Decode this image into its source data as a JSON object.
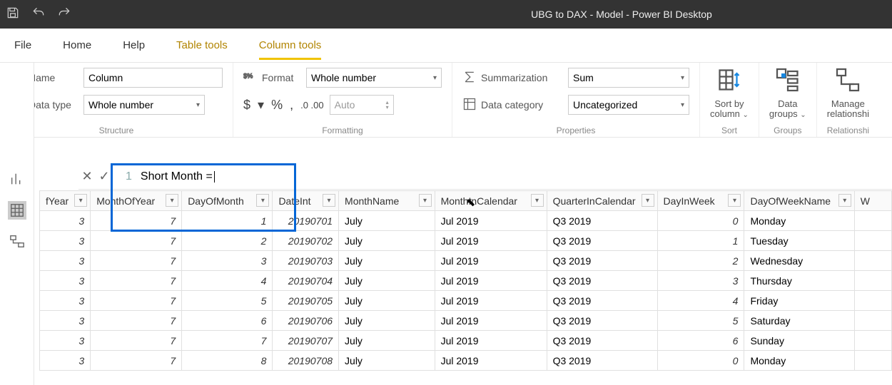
{
  "app": {
    "title": "UBG to DAX - Model - Power BI Desktop"
  },
  "menubar": {
    "file": "File",
    "home": "Home",
    "help": "Help",
    "table_tools": "Table tools",
    "column_tools": "Column tools"
  },
  "ribbon": {
    "structure": {
      "name_label": "Name",
      "name_value": "Column",
      "datatype_label": "Data type",
      "datatype_value": "Whole number",
      "caption": "Structure"
    },
    "formatting": {
      "format_label": "Format",
      "format_value": "Whole number",
      "auto": "Auto",
      "caption": "Formatting"
    },
    "properties": {
      "summarization_label": "Summarization",
      "summarization_value": "Sum",
      "category_label": "Data category",
      "category_value": "Uncategorized",
      "caption": "Properties"
    },
    "sort": {
      "label": "Sort by\ncolumn",
      "chev": "⌄",
      "caption": "Sort"
    },
    "groups": {
      "label": "Data\ngroups",
      "chev": "⌄",
      "caption": "Groups"
    },
    "rel": {
      "label": "Manage\nrelationshi",
      "caption": "Relationshi"
    }
  },
  "formula": {
    "line": "1",
    "text": "Short Month = "
  },
  "columns": [
    "fYear",
    "MonthOfYear",
    "DayOfMonth",
    "DateInt",
    "MonthName",
    "MonthInCalendar",
    "QuarterInCalendar",
    "DayInWeek",
    "DayOfWeekName",
    "W"
  ],
  "rows": [
    {
      "fYear": "3",
      "MonthOfYear": "7",
      "DayOfMonth": "1",
      "DateInt": "20190701",
      "MonthName": "July",
      "MonthInCalendar": "Jul 2019",
      "QuarterInCalendar": "Q3 2019",
      "DayInWeek": "0",
      "DayOfWeekName": "Monday"
    },
    {
      "fYear": "3",
      "MonthOfYear": "7",
      "DayOfMonth": "2",
      "DateInt": "20190702",
      "MonthName": "July",
      "MonthInCalendar": "Jul 2019",
      "QuarterInCalendar": "Q3 2019",
      "DayInWeek": "1",
      "DayOfWeekName": "Tuesday"
    },
    {
      "fYear": "3",
      "MonthOfYear": "7",
      "DayOfMonth": "3",
      "DateInt": "20190703",
      "MonthName": "July",
      "MonthInCalendar": "Jul 2019",
      "QuarterInCalendar": "Q3 2019",
      "DayInWeek": "2",
      "DayOfWeekName": "Wednesday"
    },
    {
      "fYear": "3",
      "MonthOfYear": "7",
      "DayOfMonth": "4",
      "DateInt": "20190704",
      "MonthName": "July",
      "MonthInCalendar": "Jul 2019",
      "QuarterInCalendar": "Q3 2019",
      "DayInWeek": "3",
      "DayOfWeekName": "Thursday"
    },
    {
      "fYear": "3",
      "MonthOfYear": "7",
      "DayOfMonth": "5",
      "DateInt": "20190705",
      "MonthName": "July",
      "MonthInCalendar": "Jul 2019",
      "QuarterInCalendar": "Q3 2019",
      "DayInWeek": "4",
      "DayOfWeekName": "Friday"
    },
    {
      "fYear": "3",
      "MonthOfYear": "7",
      "DayOfMonth": "6",
      "DateInt": "20190706",
      "MonthName": "July",
      "MonthInCalendar": "Jul 2019",
      "QuarterInCalendar": "Q3 2019",
      "DayInWeek": "5",
      "DayOfWeekName": "Saturday"
    },
    {
      "fYear": "3",
      "MonthOfYear": "7",
      "DayOfMonth": "7",
      "DateInt": "20190707",
      "MonthName": "July",
      "MonthInCalendar": "Jul 2019",
      "QuarterInCalendar": "Q3 2019",
      "DayInWeek": "6",
      "DayOfWeekName": "Sunday"
    },
    {
      "fYear": "3",
      "MonthOfYear": "7",
      "DayOfMonth": "8",
      "DateInt": "20190708",
      "MonthName": "July",
      "MonthInCalendar": "Jul 2019",
      "QuarterInCalendar": "Q3 2019",
      "DayInWeek": "0",
      "DayOfWeekName": "Monday"
    }
  ]
}
